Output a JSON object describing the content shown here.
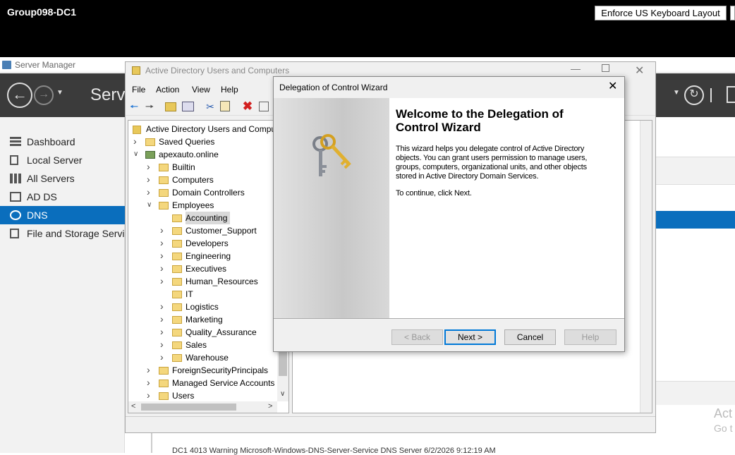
{
  "remote": {
    "host": "Group098-DC1",
    "keyboard_button": "Enforce US Keyboard Layout"
  },
  "server_manager": {
    "title": "Server Manager",
    "header_title": "Serve",
    "sidebar": [
      {
        "label": "Dashboard",
        "icon": "dashboard-icon"
      },
      {
        "label": "Local Server",
        "icon": "local-server-icon"
      },
      {
        "label": "All Servers",
        "icon": "all-servers-icon"
      },
      {
        "label": "AD DS",
        "icon": "adds-icon"
      },
      {
        "label": "DNS",
        "icon": "dns-icon",
        "selected": true
      },
      {
        "label": "File and Storage Servic",
        "icon": "storage-icon"
      }
    ],
    "watermark_line1": "Act",
    "watermark_line2": "Go t",
    "event_row": "DC1          4013   Warning   Microsoft-Windows-DNS-Server-Service   DNS Server   6/2/2026 9:12:19 AM",
    "accent": "#0a6ebd"
  },
  "aduc": {
    "title": "Active Directory Users and Computers",
    "menu": [
      "File",
      "Action",
      "View",
      "Help"
    ],
    "tree": [
      {
        "label": "Active Directory Users and Compu",
        "level": 0,
        "expander": "",
        "icon": "root"
      },
      {
        "label": "Saved Queries",
        "level": 1,
        "expander": ">",
        "icon": "folder"
      },
      {
        "label": "apexauto.online",
        "level": 1,
        "expander": "v",
        "icon": "domain"
      },
      {
        "label": "Builtin",
        "level": 2,
        "expander": ">",
        "icon": "folder"
      },
      {
        "label": "Computers",
        "level": 2,
        "expander": ">",
        "icon": "folder"
      },
      {
        "label": "Domain Controllers",
        "level": 2,
        "expander": ">",
        "icon": "ou"
      },
      {
        "label": "Employees",
        "level": 2,
        "expander": "v",
        "icon": "ou"
      },
      {
        "label": "Accounting",
        "level": 3,
        "expander": "",
        "icon": "ou",
        "selected": true
      },
      {
        "label": "Customer_Support",
        "level": 3,
        "expander": ">",
        "icon": "ou"
      },
      {
        "label": "Developers",
        "level": 3,
        "expander": ">",
        "icon": "ou"
      },
      {
        "label": "Engineering",
        "level": 3,
        "expander": ">",
        "icon": "ou"
      },
      {
        "label": "Executives",
        "level": 3,
        "expander": ">",
        "icon": "ou"
      },
      {
        "label": "Human_Resources",
        "level": 3,
        "expander": ">",
        "icon": "ou"
      },
      {
        "label": "IT",
        "level": 3,
        "expander": "",
        "icon": "ou"
      },
      {
        "label": "Logistics",
        "level": 3,
        "expander": ">",
        "icon": "ou"
      },
      {
        "label": "Marketing",
        "level": 3,
        "expander": ">",
        "icon": "ou"
      },
      {
        "label": "Quality_Assurance",
        "level": 3,
        "expander": ">",
        "icon": "ou"
      },
      {
        "label": "Sales",
        "level": 3,
        "expander": ">",
        "icon": "ou"
      },
      {
        "label": "Warehouse",
        "level": 3,
        "expander": ">",
        "icon": "ou"
      },
      {
        "label": "ForeignSecurityPrincipals",
        "level": 2,
        "expander": ">",
        "icon": "folder"
      },
      {
        "label": "Managed Service Accounts",
        "level": 2,
        "expander": ">",
        "icon": "folder"
      },
      {
        "label": "Users",
        "level": 2,
        "expander": ">",
        "icon": "folder"
      }
    ]
  },
  "wizard": {
    "title": "Delegation of Control Wizard",
    "heading": "Welcome to the Delegation of Control Wizard",
    "body": "This wizard helps you delegate control of Active Directory objects. You can grant users permission to manage users, groups, computers, organizational units, and other objects stored in Active Directory Domain Services.",
    "continue_text": "To continue, click Next.",
    "buttons": {
      "back": "< Back",
      "next": "Next >",
      "cancel": "Cancel",
      "help": "Help"
    }
  }
}
